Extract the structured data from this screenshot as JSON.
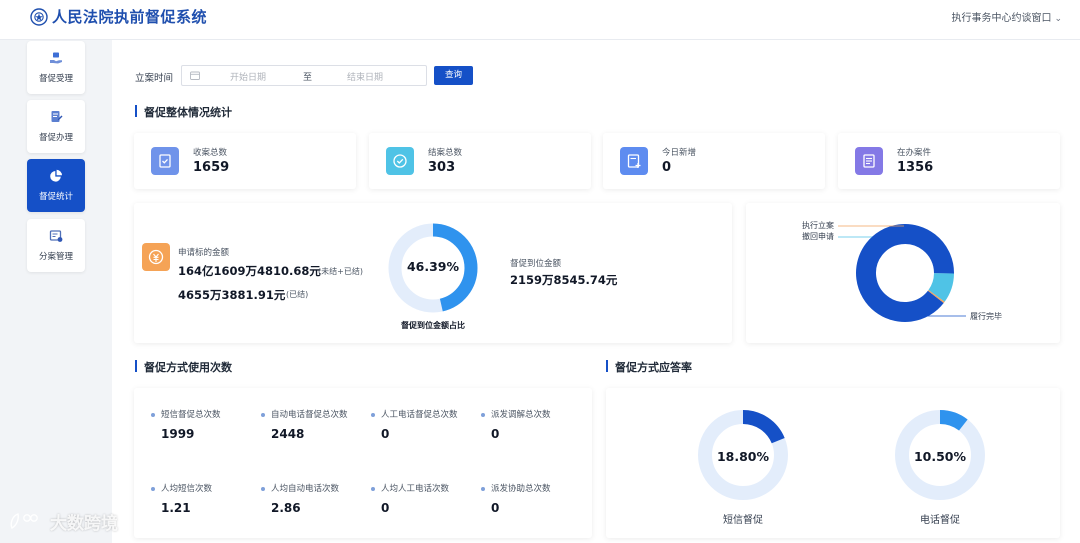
{
  "header": {
    "app_title": "人民法院执前督促系统",
    "user_menu": "执行事务中心约谈窗口"
  },
  "sidebar": {
    "items": [
      {
        "label": "督促受理",
        "icon": "inbox-hand-icon",
        "active": false
      },
      {
        "label": "督促办理",
        "icon": "document-edit-icon",
        "active": false
      },
      {
        "label": "督促统计",
        "icon": "pie-chart-icon",
        "active": true
      },
      {
        "label": "分案管理",
        "icon": "case-assign-icon",
        "active": false
      }
    ]
  },
  "filter": {
    "label": "立案时间",
    "start_placeholder": "开始日期",
    "separator": "至",
    "end_placeholder": "结束日期",
    "query_label": "查询"
  },
  "overview": {
    "title": "督促整体情况统计",
    "stats": [
      {
        "label": "收案总数",
        "value": "1659",
        "icon": "clipboard-check-icon",
        "color": "#6f93ea"
      },
      {
        "label": "结案总数",
        "value": "303",
        "icon": "circle-check-icon",
        "color": "#4fc3e6"
      },
      {
        "label": "今日新增",
        "value": "0",
        "icon": "add-document-icon",
        "color": "#5e8cf0"
      },
      {
        "label": "在办案件",
        "value": "1356",
        "icon": "document-list-icon",
        "color": "#8479e6"
      }
    ]
  },
  "amounts": {
    "apply_label": "申请标的金额",
    "apply_value_total": "164亿1609万4810.68元",
    "apply_note_total": "(未结+已结)",
    "apply_value_closed": "4655万3881.91元",
    "apply_note_closed": "(已结)",
    "ratio_value": "46.39%",
    "ratio_fraction": 0.4639,
    "ratio_caption": "督促到位金额占比",
    "paid_label": "督促到位金额",
    "paid_value": "2159万8545.74元"
  },
  "chart_data": {
    "type": "pie",
    "labels": [
      "履行完毕",
      "撤回申请",
      "执行立案"
    ],
    "values": [
      89.5,
      9.8,
      0.7
    ],
    "colors": [
      "#1550c7",
      "#4fc3e6",
      "#f0a35e"
    ]
  },
  "methods": {
    "title": "督促方式使用次数",
    "items": [
      {
        "label": "短信督促总次数",
        "value": "1999"
      },
      {
        "label": "自动电话督促总次数",
        "value": "2448"
      },
      {
        "label": "人工电话督促总次数",
        "value": "0"
      },
      {
        "label": "派发调解总次数",
        "value": "0"
      },
      {
        "label": "人均短信次数",
        "value": "1.21"
      },
      {
        "label": "人均自动电话次数",
        "value": "2.86"
      },
      {
        "label": "人均人工电话次数",
        "value": "0"
      },
      {
        "label": "派发协助总次数",
        "value": "0"
      }
    ]
  },
  "response": {
    "title": "督促方式应答率",
    "items": [
      {
        "label": "短信督促",
        "value": "18.80%",
        "fraction": 0.188,
        "color": "#1550c7"
      },
      {
        "label": "电话督促",
        "value": "10.50%",
        "fraction": 0.105,
        "color": "#2f93ee"
      }
    ]
  },
  "watermark": "大数跨境"
}
